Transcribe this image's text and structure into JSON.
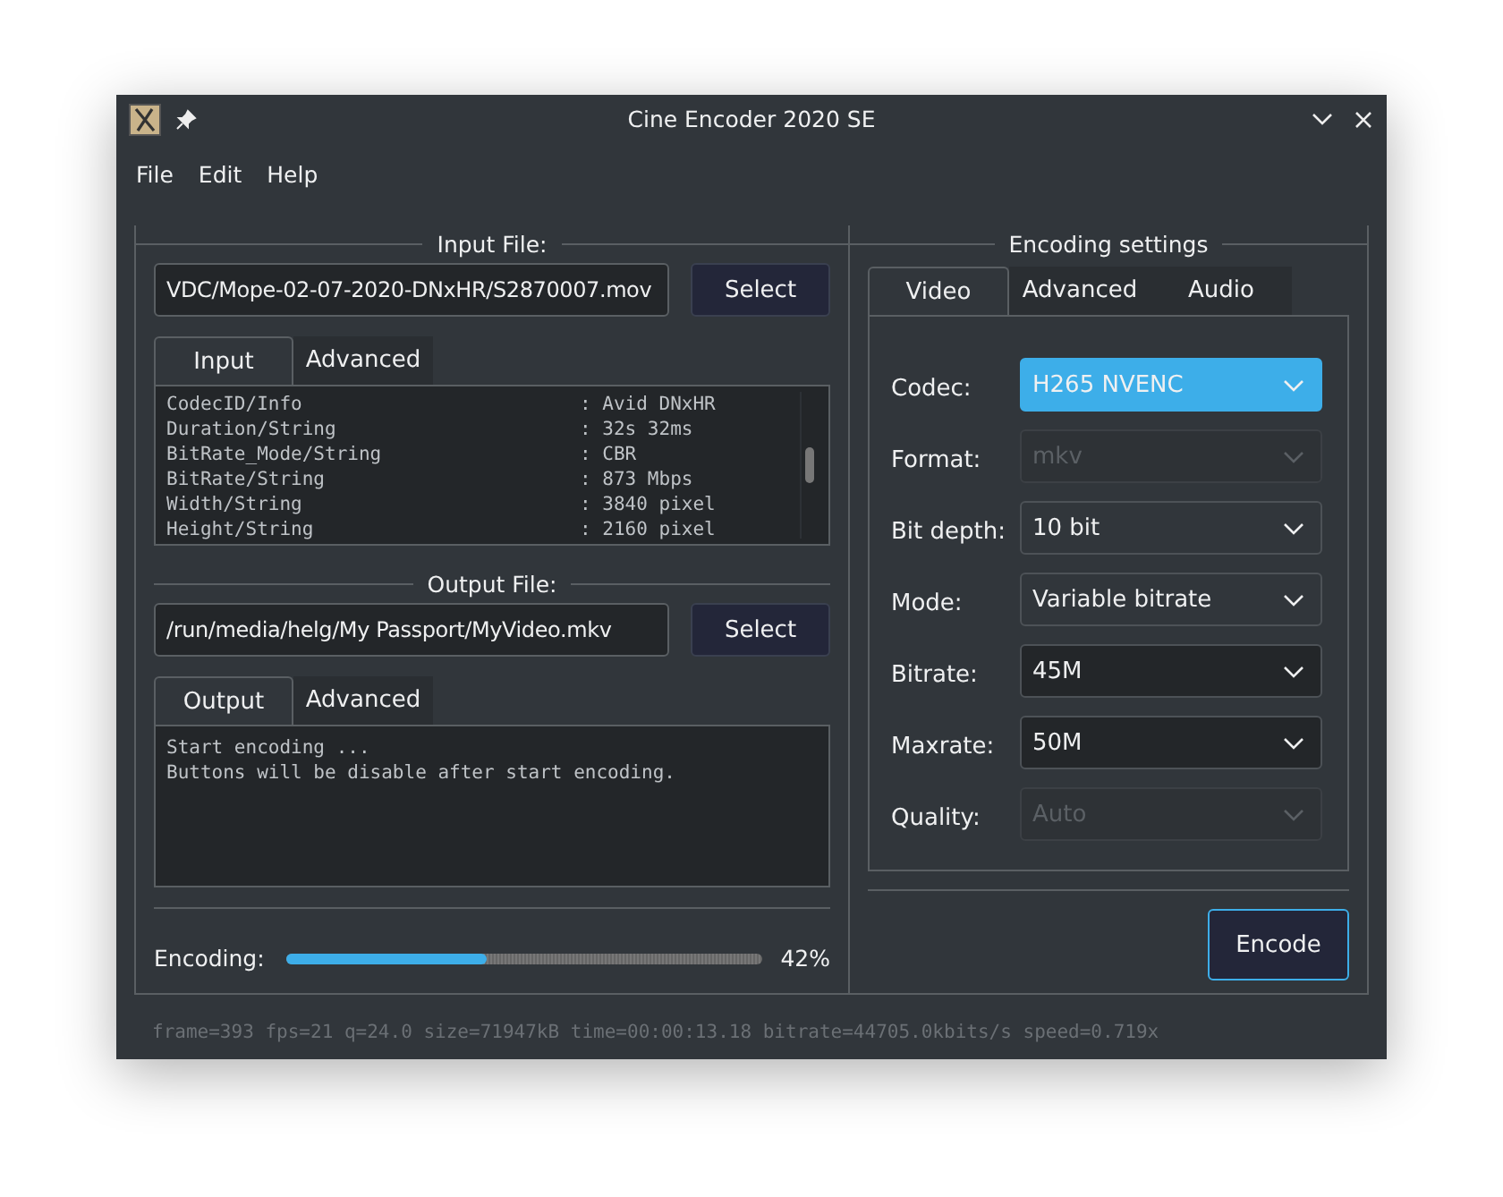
{
  "window": {
    "title": "Cine Encoder 2020 SE"
  },
  "menu": [
    {
      "label": "File"
    },
    {
      "label": "Edit"
    },
    {
      "label": "Help"
    }
  ],
  "input_file": {
    "legend": "Input File:",
    "path": "VDC/Mope-02-07-2020-DNxHR/S2870007.mov",
    "button": "Select",
    "tabs": [
      {
        "label": "Input",
        "selected": true
      },
      {
        "label": "Advanced",
        "selected": false
      }
    ],
    "info_rows": [
      {
        "key": "CodecID/Info",
        "value": ": Avid DNxHR"
      },
      {
        "key": "Duration/String",
        "value": ": 32s 32ms"
      },
      {
        "key": "BitRate_Mode/String",
        "value": ": CBR"
      },
      {
        "key": "BitRate/String",
        "value": ": 873 Mbps"
      },
      {
        "key": "Width/String",
        "value": ": 3840 pixel"
      },
      {
        "key": "Height/String",
        "value": ": 2160 pixel"
      }
    ]
  },
  "output_file": {
    "legend": "Output File:",
    "path": "/run/media/helg/My Passport/MyVideo.mkv",
    "button": "Select",
    "tabs": [
      {
        "label": "Output",
        "selected": true
      },
      {
        "label": "Advanced",
        "selected": false
      }
    ],
    "log": [
      "Start encoding ...",
      "Buttons will be disable after start encoding."
    ]
  },
  "progress": {
    "label": "Encoding:",
    "level": 0.42,
    "reading": "42%"
  },
  "encoding_settings": {
    "legend": "Encoding settings",
    "tabs": [
      {
        "label": "Video",
        "selected": true
      },
      {
        "label": "Advanced",
        "selected": false
      },
      {
        "label": "Audio",
        "selected": false
      }
    ],
    "fields": [
      {
        "label": "Codec:",
        "value": "H265 NVENC",
        "kind": "select",
        "focused": true,
        "disabled": false
      },
      {
        "label": "Format:",
        "value": "mkv",
        "kind": "select",
        "focused": false,
        "disabled": true
      },
      {
        "label": "Bit depth:",
        "value": "10 bit",
        "kind": "select",
        "focused": false,
        "disabled": false
      },
      {
        "label": "Mode:",
        "value": "Variable bitrate",
        "kind": "select",
        "focused": false,
        "disabled": false
      },
      {
        "label": "Bitrate:",
        "value": "45M",
        "kind": "editable",
        "focused": false,
        "disabled": false
      },
      {
        "label": "Maxrate:",
        "value": "50M",
        "kind": "editable",
        "focused": false,
        "disabled": false
      },
      {
        "label": "Quality:",
        "value": "Auto",
        "kind": "select",
        "focused": false,
        "disabled": true
      }
    ]
  },
  "encode_button": "Encode",
  "status_bar": "frame=393 fps=21 q=24.0 size=71947kB time=00:00:13.18 bitrate=44705.0kbits/s speed=0.719x"
}
